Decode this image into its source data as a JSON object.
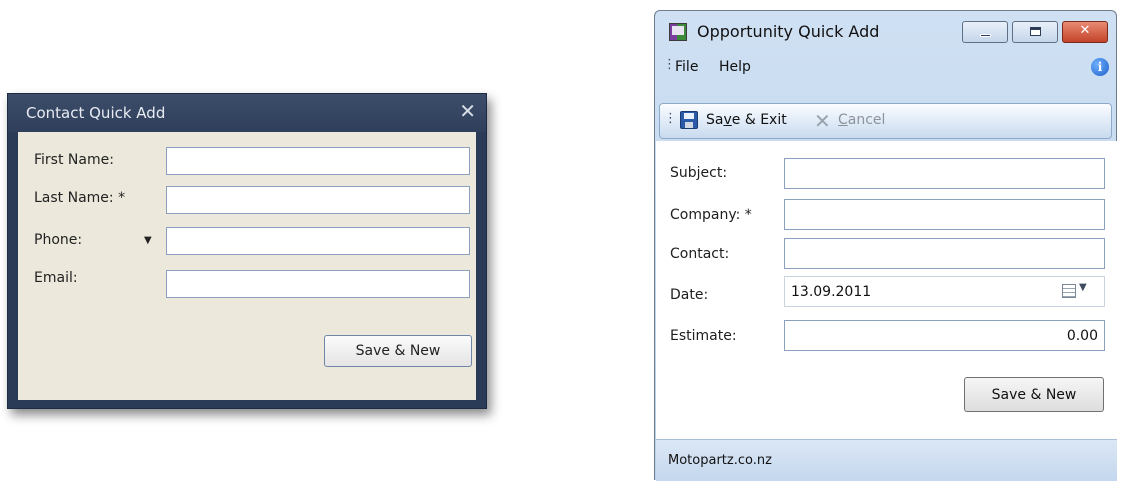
{
  "contact_dialog": {
    "title": "Contact Quick Add",
    "close_glyph": "✕",
    "fields": [
      {
        "label": "First Name:",
        "value": ""
      },
      {
        "label": "Last Name: *",
        "value": ""
      },
      {
        "label": "Phone:",
        "value": "",
        "dropdown_glyph": "▼"
      },
      {
        "label": "Email:",
        "value": ""
      }
    ],
    "save_new_label": "Save & New"
  },
  "opportunity_window": {
    "title": "Opportunity Quick Add",
    "window_buttons": {
      "close_glyph": "✕"
    },
    "menu": {
      "file": "File",
      "help": "Help",
      "info_glyph": "i"
    },
    "toolbar": {
      "save_exit_label": "Save & Exit",
      "save_exit_mnemonic": "v",
      "cancel_label": "Cancel",
      "cancel_mnemonic": "C",
      "cancel_glyph": "✕"
    },
    "fields": {
      "subject": {
        "label": "Subject:",
        "value": ""
      },
      "company": {
        "label": "Company: *",
        "value": ""
      },
      "contact": {
        "label": "Contact:",
        "value": ""
      },
      "date": {
        "label": "Date:",
        "value": "13.09.2011",
        "dropdown_glyph": "▼"
      },
      "estimate": {
        "label": "Estimate:",
        "value": "0.00"
      }
    },
    "save_new_label": "Save & New",
    "status_text": "Motopartz.co.nz"
  },
  "icons": {
    "app": "opportunity-app-icon",
    "info": "info-icon",
    "save": "floppy-disk-icon",
    "cancel": "x-icon",
    "calendar": "calendar-icon"
  },
  "colors": {
    "dark_frame": "#2a3b57",
    "dialog_body": "#ece8dc",
    "window_chrome": "#c5d9ef",
    "close_button": "#c9482c"
  }
}
